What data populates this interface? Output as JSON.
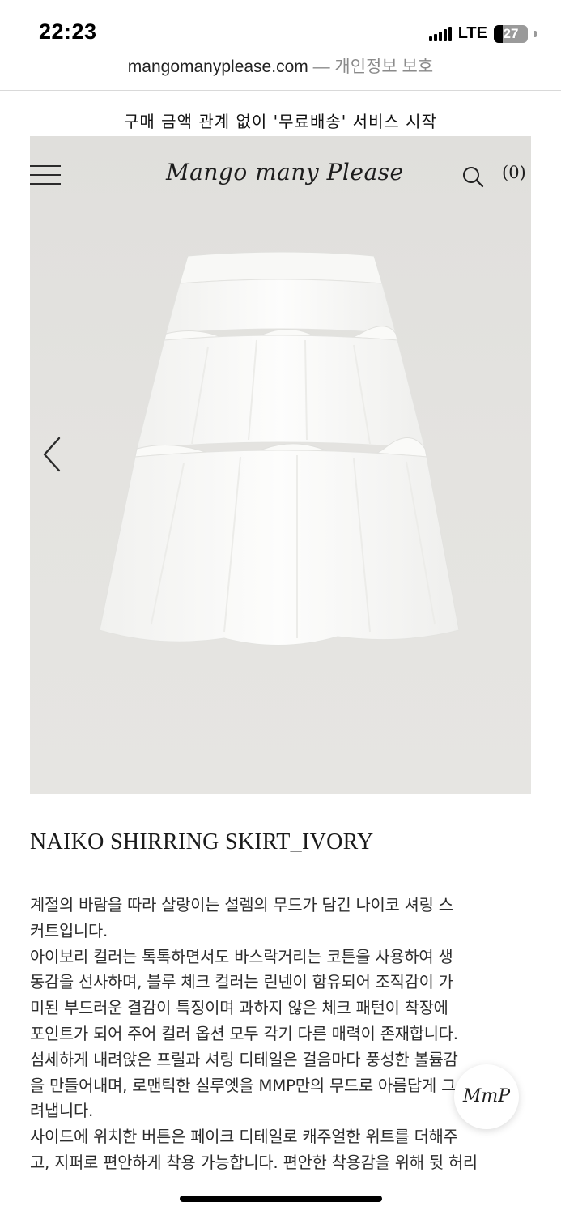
{
  "status_bar": {
    "time": "22:23",
    "network": "LTE",
    "battery_percent": "27",
    "battery_level": 0.27
  },
  "url_bar": {
    "domain": "mangomanyplease.com",
    "separator": " — ",
    "privacy_label": "개인정보 보호"
  },
  "banner": {
    "text": "구매 금액 관계 없이 '무료배송' 서비스 시작"
  },
  "header": {
    "logo_text": "Mango many Please",
    "cart_count": "(0)",
    "icons": {
      "menu": "hamburger-menu-icon",
      "search": "search-icon",
      "prev": "chevron-left-icon"
    }
  },
  "product": {
    "title": "NAIKO SHIRRING SKIRT_IVORY",
    "description_lines": [
      "계절의 바람을 따라 살랑이는 설렘의 무드가 담긴 나이코 셔링 스",
      "커트입니다.",
      "아이보리 컬러는 톡톡하면서도 바스락거리는 코튼을 사용하여 생",
      "동감을 선사하며, 블루 체크 컬러는 린넨이 함유되어 조직감이 가",
      "미된 부드러운 결감이 특징이며 과하지 않은 체크 패턴이 착장에",
      "포인트가 되어 주어 컬러 옵션 모두 각기 다른 매력이 존재합니다.",
      "섬세하게 내려앉은 프릴과 셔링 디테일은 걸음마다 풍성한 볼륨감",
      "을 만들어내며, 로맨틱한 실루엣을 MMP만의 무드로 아름답게 그",
      "려냅니다.",
      "사이드에 위치한 버튼은 페이크 디테일로 캐주얼한 위트를 더해주",
      "고, 지퍼로 편안하게 착용 가능합니다. 편안한 착용감을 위해 뒷 허리"
    ]
  },
  "floating_badge": {
    "text": "MmP"
  },
  "colors": {
    "hero_background": "#e2e1de",
    "text": "#1a1a1a"
  }
}
